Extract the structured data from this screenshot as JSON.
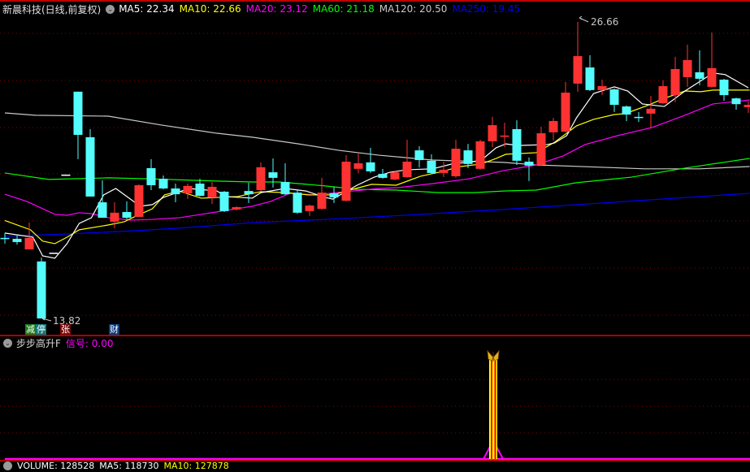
{
  "header": {
    "title": "新晨科技(日线,前复权)",
    "ma": [
      {
        "label": "MA5: 22.34",
        "color": "#ffffff"
      },
      {
        "label": "MA10: 22.66",
        "color": "#ffff00"
      },
      {
        "label": "MA20: 23.12",
        "color": "#ff00ff"
      },
      {
        "label": "MA60: 21.18",
        "color": "#00ff00"
      },
      {
        "label": "MA120: 20.50",
        "color": "#c8c8c8"
      },
      {
        "label": "MA250: 19.45",
        "color": "#0000ff"
      }
    ]
  },
  "annotations": {
    "high": "26.66",
    "low": "13.82"
  },
  "tags": [
    {
      "text": "减",
      "bg": "#1a7a1a"
    },
    {
      "text": "停",
      "bg": "#0a7a7a"
    },
    {
      "text": "张",
      "bg": "#7a0a0a"
    },
    {
      "text": "财",
      "bg": "#0a3a7a"
    }
  ],
  "indicator": {
    "name": "步步高升F",
    "signal_label": "信号: 0.00"
  },
  "volume": {
    "label": "VOLUME: 128528",
    "ma5": "MA5: 118730",
    "ma10": "MA10: 127878"
  },
  "colors": {
    "up": "#ff3232",
    "down": "#54fcfc",
    "grid": "#8a0000",
    "signal": "#ff00ff"
  },
  "chart_data": {
    "type": "candlestick",
    "price_range": [
      13.82,
      26.66
    ],
    "candles_ohlc": [
      [
        17.31,
        17.52,
        17.06,
        17.31
      ],
      [
        17.27,
        17.41,
        17.02,
        17.13
      ],
      [
        16.81,
        17.97,
        16.81,
        17.31
      ],
      [
        16.29,
        16.46,
        13.82,
        13.82
      ],
      [
        16.67,
        16.67,
        16.67,
        16.67
      ],
      [
        20.05,
        20.05,
        20.05,
        20.05
      ],
      [
        23.64,
        23.64,
        20.72,
        21.77
      ],
      [
        21.67,
        22.02,
        19.1,
        19.1
      ],
      [
        18.85,
        19.8,
        18.18,
        18.18
      ],
      [
        18.01,
        18.85,
        17.73,
        18.4
      ],
      [
        18.43,
        18.89,
        18.11,
        18.18
      ],
      [
        18.22,
        19.63,
        18.22,
        19.59
      ],
      [
        20.33,
        20.72,
        19.38,
        19.59
      ],
      [
        19.87,
        20.01,
        19.41,
        19.45
      ],
      [
        19.45,
        19.66,
        18.85,
        19.2
      ],
      [
        19.24,
        19.66,
        18.99,
        19.56
      ],
      [
        19.66,
        19.87,
        19.1,
        19.13
      ],
      [
        19.06,
        19.73,
        18.78,
        19.52
      ],
      [
        19.31,
        19.34,
        18.43,
        18.47
      ],
      [
        18.54,
        18.68,
        18.5,
        18.64
      ],
      [
        19.34,
        19.7,
        18.82,
        19.2
      ],
      [
        19.38,
        20.58,
        19.34,
        20.37
      ],
      [
        20.15,
        20.75,
        19.49,
        19.91
      ],
      [
        19.73,
        20.54,
        19.17,
        19.2
      ],
      [
        19.27,
        19.38,
        18.36,
        18.4
      ],
      [
        18.47,
        18.75,
        18.26,
        18.71
      ],
      [
        18.57,
        19.91,
        18.54,
        19.27
      ],
      [
        19.24,
        19.52,
        18.82,
        19.06
      ],
      [
        18.92,
        20.89,
        18.89,
        20.61
      ],
      [
        20.3,
        20.96,
        20.12,
        20.54
      ],
      [
        20.58,
        21.21,
        20.12,
        20.19
      ],
      [
        20.08,
        20.3,
        19.87,
        19.91
      ],
      [
        19.84,
        20.22,
        19.8,
        20.15
      ],
      [
        19.94,
        21.56,
        19.91,
        20.61
      ],
      [
        21.1,
        21.28,
        20.36,
        20.68
      ],
      [
        20.65,
        20.93,
        20.08,
        20.12
      ],
      [
        20.12,
        20.61,
        19.94,
        20.26
      ],
      [
        19.98,
        21.56,
        19.91,
        21.17
      ],
      [
        21.1,
        21.38,
        20.33,
        20.51
      ],
      [
        20.3,
        21.56,
        20.26,
        21.49
      ],
      [
        21.49,
        22.55,
        21.24,
        22.19
      ],
      [
        21.74,
        22.3,
        21.24,
        21.74
      ],
      [
        22.02,
        22.4,
        20.47,
        20.65
      ],
      [
        20.61,
        20.79,
        19.77,
        20.44
      ],
      [
        20.47,
        22.12,
        20.44,
        21.84
      ],
      [
        21.88,
        22.51,
        21.53,
        22.37
      ],
      [
        21.91,
        24.06,
        21.88,
        23.6
      ],
      [
        23.99,
        26.66,
        23.64,
        25.18
      ],
      [
        24.69,
        25.22,
        23.67,
        23.71
      ],
      [
        23.71,
        24.16,
        23.5,
        23.88
      ],
      [
        23.74,
        23.78,
        22.76,
        23.07
      ],
      [
        23.0,
        23.04,
        22.37,
        22.65
      ],
      [
        22.55,
        22.76,
        22.33,
        22.55
      ],
      [
        22.69,
        23.46,
        22.05,
        22.9
      ],
      [
        23.14,
        24.13,
        23.11,
        23.88
      ],
      [
        23.49,
        25.15,
        23.18,
        24.62
      ],
      [
        24.27,
        25.68,
        23.85,
        25.01
      ],
      [
        24.48,
        25.43,
        23.92,
        24.2
      ],
      [
        23.85,
        26.2,
        23.81,
        24.66
      ],
      [
        24.16,
        24.2,
        23.25,
        23.49
      ],
      [
        23.35,
        23.38,
        22.86,
        23.1
      ],
      [
        22.97,
        23.21,
        22.72,
        23.07
      ]
    ],
    "doji_special": [
      4,
      5
    ],
    "ma_lines": {
      "MA5": [
        [
          0,
          17.52
        ],
        [
          2.3,
          17.34
        ],
        [
          3.1,
          16.53
        ],
        [
          4.1,
          16.43
        ],
        [
          5.1,
          17.06
        ],
        [
          6.1,
          17.94
        ],
        [
          7.1,
          18.18
        ],
        [
          8.1,
          19.17
        ],
        [
          9.1,
          19.45
        ],
        [
          11.1,
          18.68
        ],
        [
          12.1,
          18.75
        ],
        [
          13,
          19.06
        ],
        [
          15.1,
          19.45
        ],
        [
          17.4,
          19.34
        ],
        [
          18.1,
          19.1
        ],
        [
          20.3,
          19.03
        ],
        [
          21,
          19.27
        ],
        [
          23,
          19.45
        ],
        [
          24.7,
          19.34
        ],
        [
          26.3,
          19.06
        ],
        [
          26.9,
          18.99
        ],
        [
          28.9,
          19.59
        ],
        [
          30.3,
          19.94
        ],
        [
          31.6,
          20.15
        ],
        [
          33,
          20.26
        ],
        [
          35.1,
          20.3
        ],
        [
          36.9,
          20.54
        ],
        [
          38.1,
          20.58
        ],
        [
          39.1,
          20.68
        ],
        [
          40.3,
          21.21
        ],
        [
          41.1,
          21.38
        ],
        [
          42.1,
          21.31
        ],
        [
          44.5,
          21.35
        ],
        [
          45.1,
          21.42
        ],
        [
          46.1,
          21.74
        ],
        [
          46.9,
          22.51
        ],
        [
          48.3,
          23.56
        ],
        [
          50,
          23.85
        ],
        [
          51.1,
          23.67
        ],
        [
          52.3,
          23.11
        ],
        [
          54.1,
          23.0
        ],
        [
          55.8,
          23.67
        ],
        [
          58.1,
          24.45
        ],
        [
          59.1,
          24.38
        ],
        [
          61,
          23.81
        ]
      ],
      "MA10": [
        [
          0,
          18.06
        ],
        [
          2.1,
          17.66
        ],
        [
          3.1,
          17.17
        ],
        [
          4.1,
          17.06
        ],
        [
          5.1,
          17.34
        ],
        [
          6.1,
          17.66
        ],
        [
          8.5,
          17.87
        ],
        [
          9.8,
          18.01
        ],
        [
          10.9,
          18.29
        ],
        [
          12.1,
          18.57
        ],
        [
          13.1,
          19.17
        ],
        [
          14.3,
          19.34
        ],
        [
          16.1,
          19.03
        ],
        [
          17.4,
          19.06
        ],
        [
          19.1,
          19.1
        ],
        [
          20.3,
          19.24
        ],
        [
          21,
          19.31
        ],
        [
          23.1,
          19.27
        ],
        [
          24.9,
          19.17
        ],
        [
          26.9,
          19.17
        ],
        [
          28.5,
          19.41
        ],
        [
          30.1,
          19.63
        ],
        [
          32.1,
          19.59
        ],
        [
          34.1,
          19.98
        ],
        [
          35.6,
          20.15
        ],
        [
          37.4,
          20.4
        ],
        [
          39.1,
          20.51
        ],
        [
          40.3,
          20.75
        ],
        [
          41.1,
          20.93
        ],
        [
          43.6,
          21.0
        ],
        [
          45.1,
          21.45
        ],
        [
          46.9,
          22.16
        ],
        [
          48.3,
          22.44
        ],
        [
          50,
          22.65
        ],
        [
          50.9,
          22.69
        ],
        [
          52.7,
          23.04
        ],
        [
          54.1,
          23.35
        ],
        [
          55.8,
          23.67
        ],
        [
          57.1,
          23.64
        ],
        [
          58.1,
          23.71
        ],
        [
          61.1,
          23.71
        ]
      ],
      "MA20": [
        [
          0,
          19.2
        ],
        [
          1.8,
          18.89
        ],
        [
          4.1,
          18.33
        ],
        [
          5.1,
          18.29
        ],
        [
          6.1,
          18.4
        ],
        [
          7.1,
          18.36
        ],
        [
          8.5,
          18.18
        ],
        [
          10.3,
          18.08
        ],
        [
          12.1,
          18.11
        ],
        [
          14.3,
          18.18
        ],
        [
          16.5,
          18.36
        ],
        [
          20.3,
          18.68
        ],
        [
          21.8,
          18.89
        ],
        [
          23.4,
          19.24
        ],
        [
          25.4,
          19.17
        ],
        [
          28.5,
          19.34
        ],
        [
          30.7,
          19.45
        ],
        [
          32.3,
          19.49
        ],
        [
          35.1,
          19.66
        ],
        [
          38.1,
          19.87
        ],
        [
          40.9,
          20.22
        ],
        [
          43.6,
          20.47
        ],
        [
          45.8,
          20.86
        ],
        [
          47.6,
          21.35
        ],
        [
          50.3,
          21.74
        ],
        [
          53.1,
          22.09
        ],
        [
          55.8,
          22.62
        ],
        [
          58.1,
          23.11
        ],
        [
          61.1,
          23.28
        ]
      ],
      "MA60": [
        [
          0,
          20.12
        ],
        [
          3.6,
          19.84
        ],
        [
          8.5,
          19.91
        ],
        [
          11.8,
          19.87
        ],
        [
          17.4,
          19.77
        ],
        [
          20.3,
          19.73
        ],
        [
          22.5,
          19.73
        ],
        [
          26.3,
          19.56
        ],
        [
          28.9,
          19.41
        ],
        [
          32.1,
          19.38
        ],
        [
          35.6,
          19.27
        ],
        [
          38.5,
          19.27
        ],
        [
          40.9,
          19.34
        ],
        [
          43.6,
          19.38
        ],
        [
          46.9,
          19.7
        ],
        [
          51.4,
          19.94
        ],
        [
          55.8,
          20.33
        ],
        [
          61.1,
          20.75
        ]
      ],
      "MA120": [
        [
          0,
          22.72
        ],
        [
          2.5,
          22.62
        ],
        [
          8.5,
          22.58
        ],
        [
          12.9,
          22.19
        ],
        [
          17.4,
          21.84
        ],
        [
          20.3,
          21.67
        ],
        [
          24.1,
          21.38
        ],
        [
          27.4,
          21.1
        ],
        [
          30.7,
          20.89
        ],
        [
          35.1,
          20.68
        ],
        [
          40.9,
          20.58
        ],
        [
          43.6,
          20.47
        ],
        [
          52.5,
          20.3
        ],
        [
          57,
          20.3
        ],
        [
          61.1,
          20.4
        ]
      ],
      "MA250": [
        [
          0,
          17.38
        ],
        [
          5.1,
          17.48
        ],
        [
          10.7,
          17.62
        ],
        [
          15.1,
          17.76
        ],
        [
          20.3,
          17.97
        ],
        [
          26.3,
          18.11
        ],
        [
          32.9,
          18.29
        ],
        [
          40.9,
          18.54
        ],
        [
          61.1,
          19.24
        ]
      ]
    },
    "signal": {
      "values_nonzero": [
        [
          40,
          1
        ]
      ],
      "baseline": 0
    }
  }
}
